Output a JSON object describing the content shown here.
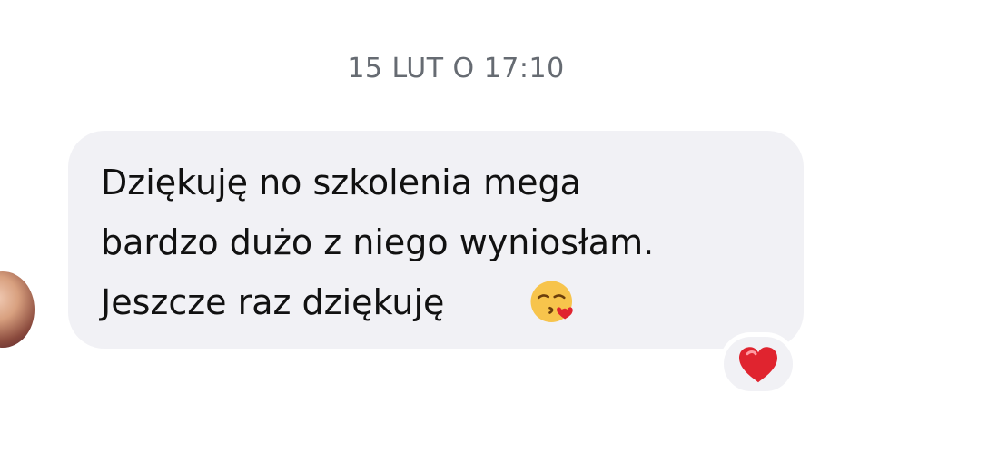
{
  "timestamp": "15 LUT O 17:10",
  "message": {
    "text": "Dziękuję no szkolenia mega\nbardzo dużo z niego wyniosłam.\nJeszcze raz dziękuję",
    "emoji": "kiss-face-icon"
  },
  "reaction": {
    "icon": "heart-icon"
  },
  "colors": {
    "bubble_bg": "#f1f1f5",
    "timestamp_text": "#666b72",
    "message_text": "#111111",
    "heart": "#e0242f"
  }
}
